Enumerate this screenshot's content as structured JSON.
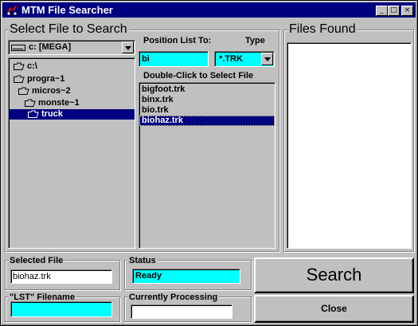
{
  "window": {
    "title": "MTM File Searcher",
    "min_glyph": "_",
    "max_glyph": "□",
    "close_glyph": "×"
  },
  "select_file": {
    "title": "Select File to Search",
    "drive": "c: [MEGA]",
    "tree": [
      {
        "label": "c:\\",
        "selected": false
      },
      {
        "label": "progra~1",
        "selected": false
      },
      {
        "label": "micros~2",
        "selected": false
      },
      {
        "label": "monste~1",
        "selected": false
      },
      {
        "label": "truck",
        "selected": true
      }
    ],
    "position_label": "Position List To:",
    "position_value": "bi",
    "type_label": "Type",
    "type_value": "*.TRK",
    "file_list_label": "Double-Click to Select File",
    "files": [
      {
        "label": "bigfoot.trk",
        "selected": false
      },
      {
        "label": "binx.trk",
        "selected": false
      },
      {
        "label": "bio.trk",
        "selected": false
      },
      {
        "label": "biohaz.trk",
        "selected": true
      }
    ]
  },
  "files_found": {
    "title": "Files Found",
    "items": []
  },
  "selected_file": {
    "label": "Selected File",
    "value": "biohaz.trk"
  },
  "lst_filename": {
    "label": "\"LST\" Filename",
    "value": ""
  },
  "status": {
    "label": "Status",
    "value": "Ready"
  },
  "currently_processing": {
    "label": "Currently Processing",
    "value": ""
  },
  "buttons": {
    "search": "Search",
    "close": "Close"
  },
  "colors": {
    "title_bar": "#000080",
    "face": "#c0c0c0",
    "highlight_input": "#00ffff",
    "selection": "#000080"
  }
}
